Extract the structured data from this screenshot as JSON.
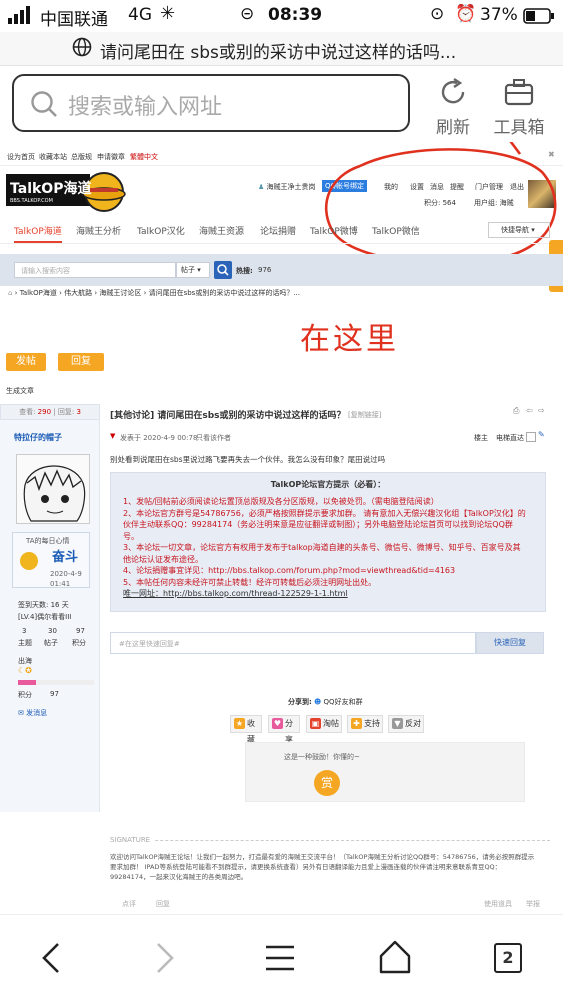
{
  "status": {
    "carrier": "中国联通",
    "network": "4G",
    "time": "08:39",
    "battery": "37%"
  },
  "url_bar": {
    "title": "请问尾田在 sbs或别的采访中说过这样的话吗..."
  },
  "browser": {
    "search_placeholder": "搜索或输入网址",
    "refresh_label": "刷新",
    "tools_label": "工具箱"
  },
  "site": {
    "topbar": [
      "设为首页",
      "收藏本站",
      "总版规",
      "申请徽章",
      "繁體中文"
    ],
    "logo_text": "TalkOP海道",
    "logo_sub": "BBS.TALKOP.COM",
    "user": {
      "slogan": "海贼王净土贵岗",
      "qq": "QQ帐号绑定",
      "menu": [
        "我的",
        "设置",
        "消息",
        "提醒",
        "门户管理",
        "退出"
      ],
      "points": "积分: 564",
      "group": "用户组: 海贼"
    },
    "nav": [
      "TalkOP海道",
      "海贼王分析",
      "TalkOP汉化",
      "海贼王资源",
      "论坛捐赠",
      "TalkOP微博",
      "TalkOP微信"
    ],
    "quicknav": "快捷导航",
    "search_placeholder": "请输入搜索内容",
    "search_type": "帖子",
    "hot_label": "热搜:",
    "hot_value": "976",
    "breadcrumb": [
      "TalkOP海道",
      "伟大航路",
      "海贼王讨论区",
      "请问尾田在sbs或别的采访中说过这样的话吗？..."
    ],
    "annotation": "在这里",
    "post_button": "发帖",
    "reply_button": "回复",
    "gen_article": "生成文章"
  },
  "thread": {
    "views_label": "查看:",
    "views": "290",
    "replies_label": "回复:",
    "replies": "3",
    "title": "[其他讨论] 请问尾田在sbs或别的采访中说过这样的话吗？",
    "copy_link": "[复制链接]",
    "author_name": "特拉仔的帽子",
    "post_meta": "发表于 2020-4-9 00:78",
    "only_author": "只看该作者",
    "floor": "楼主",
    "jump": "电梯直达",
    "body": "别处看到说尾田在sbs里说过路飞要再失去一个伙伴。我怎么没有印象？尾田说过吗",
    "notice_title": "TalkOP论坛官方提示（必看）：",
    "notice_lines": [
      "1、发帖/回帖前必须阅读论坛置顶总版规及各分区版规，以免被处罚。（需电脑登陆阅读）",
      "2、本论坛官方群号是54786756，必须严格按照群提示要求加群。 请有意加入无偿兴趣汉化组【TalkOP汉化】的",
      "伙伴主动联系QQ：99284174（务必注明来意是应征翻译或制图）；另外电脑登陆论坛首页可以找到论坛QQ群",
      "号。",
      "3、本论坛一切文章，论坛官方有权用于发布于talkop海道自建的头条号、微信号、微博号、知乎号、百家号及其",
      "他论坛认证发布途径。",
      "4、论坛捐赠事宜详见：http://bbs.talkop.com/forum.php?mod=viewthread&tid=4163",
      "5、本帖任何内容未经许可禁止转载！经许可转载后必须注明网址出处。"
    ],
    "unique_url": "唯一网址：http://bbs.talkop.com/thread-122529-1-1.html",
    "quick_reply_placeholder": "#在这里快速回复#",
    "quick_reply_button": "快速回复",
    "share_label": "分享到:",
    "share_target": "QQ好友和群",
    "actions": [
      "收藏",
      "分享",
      "淘帖",
      "支持",
      "反对"
    ],
    "reward_text": "这是一种鼓励！你懂的~",
    "reward_button": "赏",
    "signature_label": "SIGNATURE",
    "signature_text": [
      "欢迎访问TalkOP海贼王论坛！让我们一起努力，打造最有爱的海贼王交流平台！（TalkOP海贼王分析讨论QQ群号：54786756，请务必按照群提示",
      "要求加群！ IPAD等系统登陆可能看不到群提示，请更换系统查看）另外有日语翻译能力且爱上漫画连载的伙伴请注明来意联系青豆QQ：",
      "99284174，一起来汉化海贼王的各类周边吧。"
    ],
    "footer_left": [
      "点评",
      "回复"
    ],
    "footer_right": [
      "使用道具",
      "举报"
    ]
  },
  "profile": {
    "daily_mood": "TA的每日心情",
    "mood_word": "奋斗",
    "mood_date": "2020-4-9",
    "mood_time": "01:41",
    "checkin": "签到天数: 16 天",
    "level": "[LV.4]偶尔看看III",
    "stats": [
      {
        "v": "3",
        "k": "主题"
      },
      {
        "v": "30",
        "k": "帖子"
      },
      {
        "v": "97",
        "k": "积分"
      }
    ],
    "rank": "出海",
    "points_label": "积分",
    "points": "97",
    "message": "发消息"
  },
  "bottom": {
    "tab_count": "2"
  }
}
